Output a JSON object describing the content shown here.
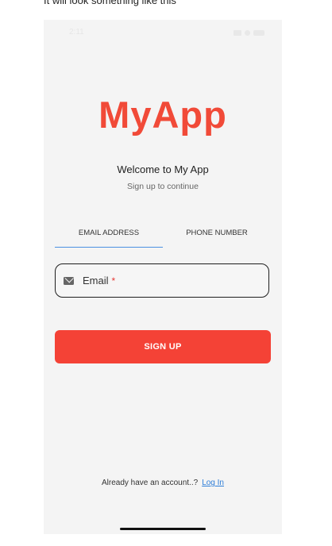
{
  "caption": "It will look something like this",
  "status_bar": {
    "time": "2:11",
    "icons": [
      "signal-icon",
      "wifi-icon",
      "battery-icon"
    ]
  },
  "app": {
    "logo": "MyApp",
    "welcome": "Welcome to My App",
    "subtitle": "Sign up to continue",
    "tabs": [
      {
        "label": "EMAIL ADDRESS",
        "active": true
      },
      {
        "label": "PHONE NUMBER",
        "active": false
      }
    ],
    "email_field": {
      "label": "Email",
      "required_mark": "*",
      "icon": "mail-icon"
    },
    "signup_label": "SIGN UP",
    "footer": {
      "text": "Already have an account..?",
      "link": "Log In"
    }
  },
  "colors": {
    "brand": "#f14a38",
    "button": "#f44236",
    "tab_indicator": "#4a90e2",
    "link": "#2f7ed8"
  }
}
